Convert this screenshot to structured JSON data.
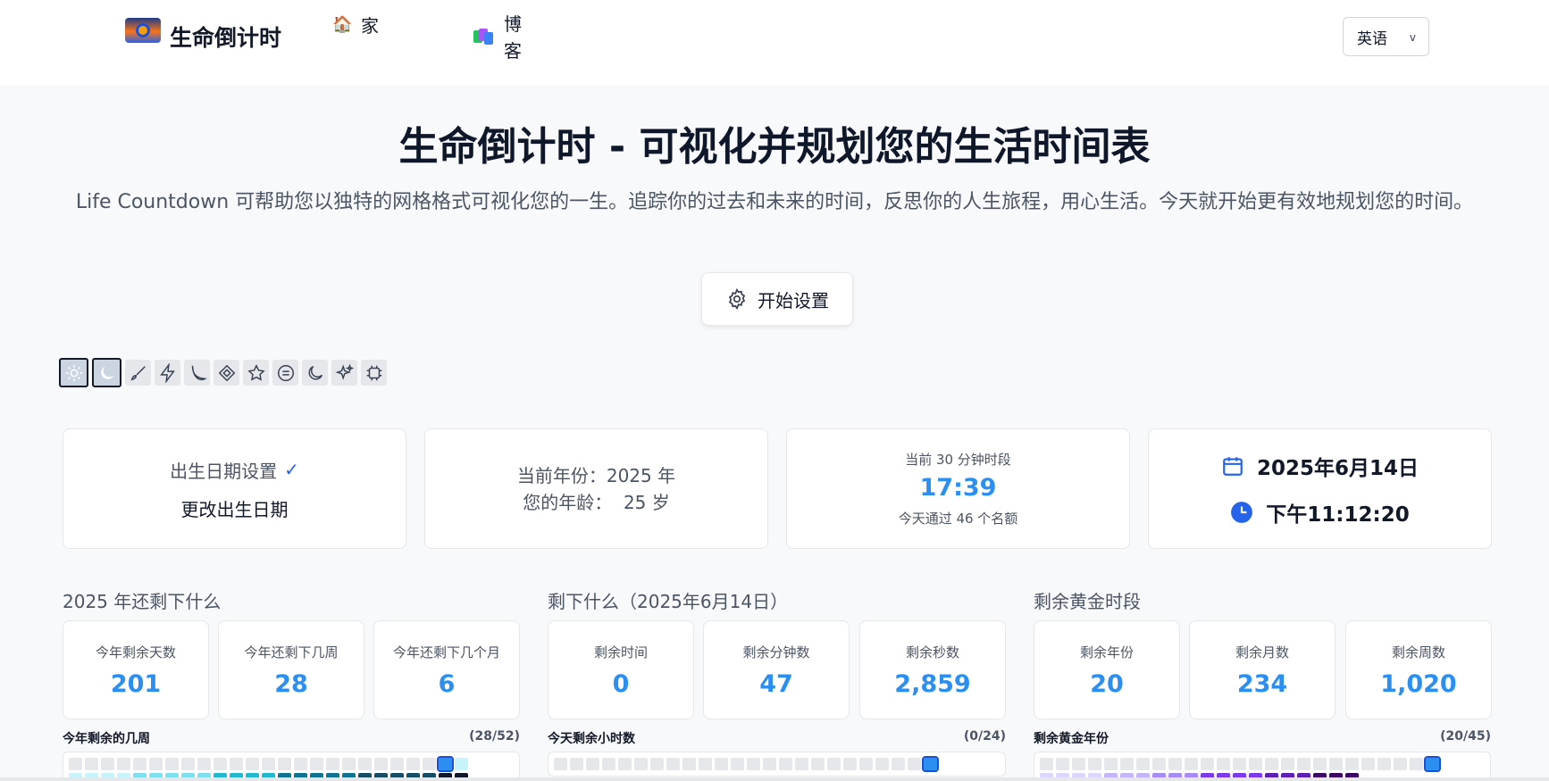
{
  "header": {
    "brand": "生命倒计时",
    "nav_home": "家",
    "nav_blog": "博客",
    "language": "英语"
  },
  "hero": {
    "title": "生命倒计时 - 可视化并规划您的生活时间表",
    "subtitle": "Life Countdown 可帮助您以独特的网格格式可视化您的一生。追踪你的过去和未来的时间，反思你的人生旅程，用心生活。今天就开始更有效地规划您的时间。",
    "start_button": "开始设置"
  },
  "themes": [
    "sun-icon",
    "moon-icon",
    "brush-icon",
    "lightning-icon",
    "crescent-icon",
    "tag-icon",
    "star-icon",
    "minus-circle-icon",
    "moon-outline-icon",
    "sparkles-icon",
    "chip-icon"
  ],
  "cards": {
    "birth_label": "出生日期设置",
    "change_birth": "更改出生日期",
    "current_year": "当前年份：2025 年",
    "age": "您的年龄：  25 岁",
    "slot_caption": "当前 30 分钟时段",
    "slot_time": "17:39",
    "slot_note": "今天通过 46 个名额",
    "date": "2025年6月14日",
    "time": "下午11:12:20"
  },
  "sections": [
    {
      "title": "2025 年还剩下什么",
      "stats": [
        {
          "label": "今年剩余天数",
          "value": "201"
        },
        {
          "label": "今年还剩下几周",
          "value": "28"
        },
        {
          "label": "今年还剩下几个月",
          "value": "6"
        }
      ],
      "bar_title": "今年剩余的几周",
      "bar_count": "(28/52)"
    },
    {
      "title": "剩下什么（2025年6月14日）",
      "stats": [
        {
          "label": "剩余时间",
          "value": "0"
        },
        {
          "label": "剩余分钟数",
          "value": "47"
        },
        {
          "label": "剩余秒数",
          "value": "2,859"
        }
      ],
      "bar_title": "今天剩余小时数",
      "bar_count": "(0/24)"
    },
    {
      "title": "剩余黄金时段",
      "stats": [
        {
          "label": "剩余年份",
          "value": "20"
        },
        {
          "label": "剩余月数",
          "value": "234"
        },
        {
          "label": "剩余周数",
          "value": "1,020"
        }
      ],
      "bar_title": "剩余黄金年份",
      "bar_count": "(20/45)"
    }
  ],
  "colors": {
    "accent": "#2b8ff2",
    "calendar": "#2563eb",
    "text": "#111827"
  }
}
